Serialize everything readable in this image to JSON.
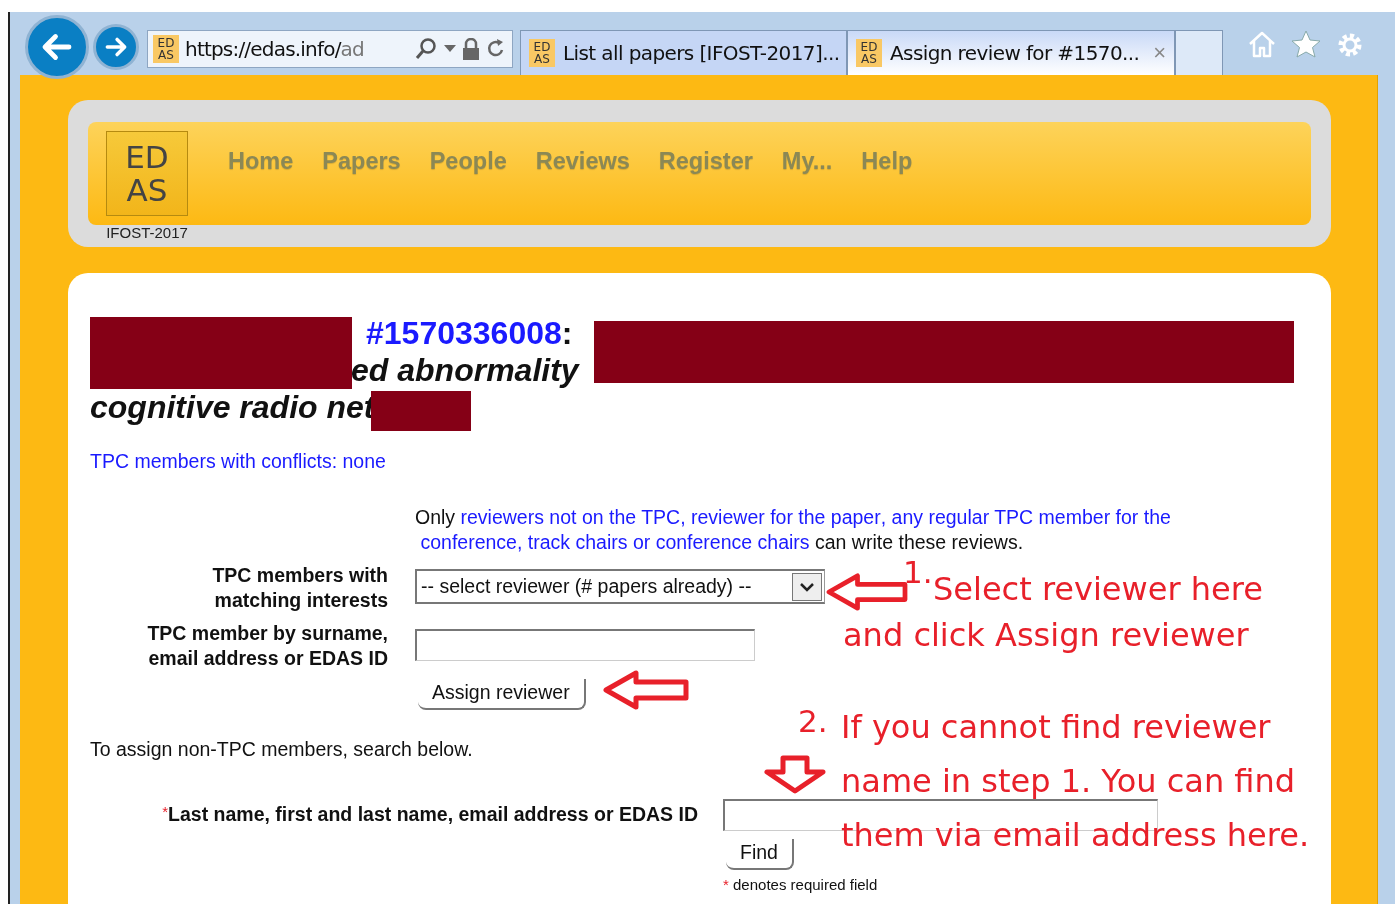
{
  "browser": {
    "address": {
      "favicon": [
        "ED",
        "AS"
      ],
      "url_host": "https://edas.info/",
      "url_path": "ad"
    },
    "tabs": [
      {
        "favicon": [
          "ED",
          "AS"
        ],
        "label": "List all papers [IFOST-2017]...",
        "selected": false
      },
      {
        "favicon": [
          "ED",
          "AS"
        ],
        "label": "Assign review for #1570...",
        "selected": true,
        "close": "×"
      }
    ]
  },
  "header": {
    "logo": [
      "ED",
      "AS"
    ],
    "conference": "IFOST-2017",
    "nav": [
      "Home",
      "Papers",
      "People",
      "Reviews",
      "Register",
      "My...",
      "Help"
    ]
  },
  "title": {
    "number": "#1570336008",
    "separator": ":",
    "fragments": [
      "ed abnormality",
      "cognitive radio net"
    ]
  },
  "conflicts": "TPC members with conflicts: none",
  "note": [
    {
      "kind": "text",
      "text": "Only "
    },
    {
      "kind": "link",
      "text": "reviewers not on the TPC"
    },
    {
      "kind": "link_text",
      "text": ", "
    },
    {
      "kind": "link",
      "text": "reviewer for the paper"
    },
    {
      "kind": "link_text",
      "text": ", "
    },
    {
      "kind": "link",
      "text": "any regular TPC member for the"
    },
    {
      "kind": "link",
      "text": "conference"
    },
    {
      "kind": "link_text",
      "text": ", "
    },
    {
      "kind": "link",
      "text": "track chairs"
    },
    {
      "kind": "link_text",
      "text": " or "
    },
    {
      "kind": "link",
      "text": "conference chairs"
    },
    {
      "kind": "text",
      "text": " can write these reviews."
    }
  ],
  "form": {
    "matching_label": "TPC members with matching interests",
    "select_value": "-- select reviewer (# papers already) --",
    "surname_label": "TPC member by surname, email address or EDAS ID",
    "assign_button": "Assign reviewer"
  },
  "non_tpc_hint": "To assign non-TPC members, search below.",
  "search": {
    "required_mark": "*",
    "label": "Last name, first and last name, email address or EDAS ID",
    "find_button": "Find",
    "footnote_mark": "*",
    "footnote": "denotes required field"
  },
  "annotations": [
    {
      "number": "1.",
      "lines": [
        "Select reviewer here",
        "and click Assign reviewer"
      ]
    },
    {
      "number": "2.",
      "lines": [
        "If you cannot find reviewer",
        "name in step 1. You can find",
        "them via email address here."
      ]
    }
  ]
}
